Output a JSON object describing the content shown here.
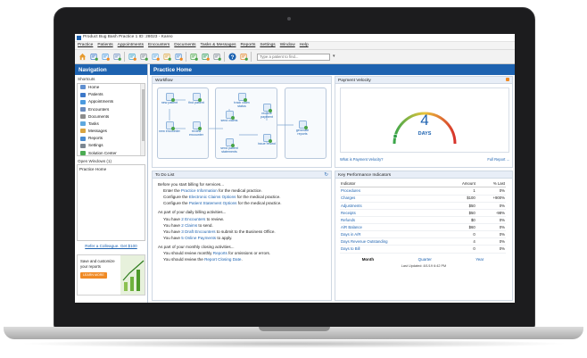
{
  "window": {
    "title": "Product Bug Bash Practice 1 ID: 28023 - Kareo"
  },
  "menu": [
    "Practice",
    "Patients",
    "Appointments",
    "Encounters",
    "Documents",
    "Tasks & Messages",
    "Reports",
    "Settings",
    "Window",
    "Help"
  ],
  "toolbar": {
    "buttons": [
      "home-icon",
      "patient-icon",
      "appointment-icon",
      "encounter-icon",
      "calendar-icon",
      "document-icon",
      "task-icon",
      "message-icon",
      "report-icon",
      "claim-icon",
      "payment-icon",
      "settings-icon",
      "help-icon",
      "gear-icon"
    ],
    "search_placeholder": "Type a patient to find..."
  },
  "nav": {
    "header": "Navigation",
    "shortcuts_label": "Shortcuts",
    "shortcuts": [
      {
        "label": "Home",
        "color": "#5f8fd0"
      },
      {
        "label": "Patients",
        "color": "#3d78c8"
      },
      {
        "label": "Appointments",
        "color": "#4b9adf"
      },
      {
        "label": "Encounters",
        "color": "#6a8bbd"
      },
      {
        "label": "Documents",
        "color": "#8c8c8c"
      },
      {
        "label": "Tasks",
        "color": "#5fa8de"
      },
      {
        "label": "Messages",
        "color": "#d9a441"
      },
      {
        "label": "Reports",
        "color": "#4a8bd0"
      },
      {
        "label": "Settings",
        "color": "#7c8792"
      },
      {
        "label": "Solution Center",
        "color": "#4bab52"
      }
    ],
    "open_windows_label": "Open Windows (1)",
    "open_windows": [
      "Practice Home"
    ],
    "refer_link": "Refer a Colleague. Get $100",
    "promo": {
      "text": "Save and customize your reports",
      "button": "LEARN MORE"
    }
  },
  "main": {
    "header": "Practice Home",
    "workflow": {
      "title": "Workflow",
      "nodes": [
        "new patient",
        "find patient",
        "new encounter",
        "review encounter",
        "track claim status",
        "send claims",
        "send patient statements",
        "receive payment",
        "issue refund",
        "generate reports"
      ]
    },
    "velocity": {
      "title": "Payment Velocity",
      "value": "4",
      "unit": "DAYS",
      "gauge_fraction": 0.08,
      "link_left": "What is Payment Velocity?",
      "link_right": "Full Report ..."
    },
    "todo": {
      "title": "To Do List",
      "sections": [
        {
          "heading": "Before you start billing for services...",
          "items": [
            {
              "pre": "Enter the ",
              "link": "Practice Information",
              "post": " for the medical practice."
            },
            {
              "pre": "Configure the ",
              "link": "Electronic Claims Options",
              "post": " for the medical practice."
            },
            {
              "pre": "Configure the ",
              "link": "Patient Statement Options",
              "post": " for the medical practice."
            }
          ]
        },
        {
          "heading": "As part of your daily billing activities...",
          "items": [
            {
              "pre": "You have ",
              "link": "2 Encounters",
              "post": " to review."
            },
            {
              "pre": "You have ",
              "link": "2 Claims",
              "post": " to send."
            },
            {
              "pre": "You have ",
              "link": "3 Draft Encounters",
              "post": " to submit to the Business Office."
            },
            {
              "pre": "You have ",
              "link": "5 Online Payments",
              "post": " to apply."
            }
          ]
        },
        {
          "heading": "As part of your monthly closing activities...",
          "items": [
            {
              "pre": "You should review monthly ",
              "link": "Reports",
              "post": " for omissions or errors."
            },
            {
              "pre": "You should review the ",
              "link": "Report Closing Date",
              "post": "."
            }
          ]
        }
      ]
    },
    "kpi": {
      "title": "Key Performance Indicators",
      "columns": [
        "Indicator",
        "Amount",
        "% Last"
      ],
      "rows": [
        [
          "Procedures",
          "1",
          "0%"
        ],
        [
          "Charges",
          "$100",
          "+900%"
        ],
        [
          "Adjustments",
          "$50",
          "0%"
        ],
        [
          "Receipts",
          "$50",
          "-98%"
        ],
        [
          "Refunds",
          "$0",
          "0%"
        ],
        [
          "A/R Balance",
          "$60",
          "0%"
        ],
        [
          "Days in A/R",
          "0",
          "0%"
        ],
        [
          "Days Revenue Outstanding",
          "4",
          "0%"
        ],
        [
          "Days to Bill",
          "0",
          "0%"
        ]
      ],
      "periods": [
        "Month",
        "Quarter",
        "Year"
      ],
      "active_period": "Month",
      "updated": "Last Updated: 8/1/19 6:42 PM"
    }
  }
}
